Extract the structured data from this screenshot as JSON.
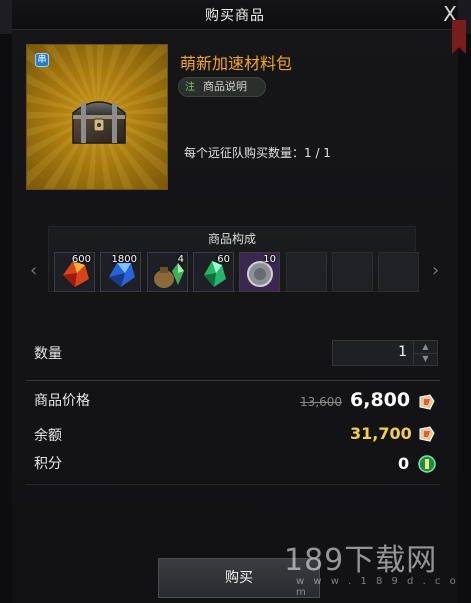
{
  "dialog": {
    "title": "购买商品",
    "close_label": "X"
  },
  "item": {
    "name": "萌新加速材料包",
    "badge": "串",
    "description_button": "商品说明",
    "description_icon": "注",
    "purchase_limit": "每个远征队购买数量：1 / 1"
  },
  "composition": {
    "title": "商品构成",
    "slots": [
      {
        "icon": "red-gem-icon",
        "qty": "600"
      },
      {
        "icon": "blue-gem-icon",
        "qty": "1800"
      },
      {
        "icon": "pouch-gem-icon",
        "qty": "4"
      },
      {
        "icon": "green-gem-icon",
        "qty": "60"
      },
      {
        "icon": "purple-coin-icon",
        "qty": "10"
      },
      {
        "icon": "",
        "qty": ""
      },
      {
        "icon": "",
        "qty": ""
      },
      {
        "icon": "",
        "qty": ""
      }
    ]
  },
  "quantity": {
    "label": "数量",
    "value": "1"
  },
  "price": {
    "label": "商品价格",
    "original": "13,600",
    "current": "6,800"
  },
  "balance": {
    "label": "余额",
    "value": "31,700"
  },
  "points": {
    "label": "积分",
    "value": "0"
  },
  "buy_button": "购买",
  "watermark": {
    "text": "189下载网",
    "url": "w w w . 1 8 9 d . c o m"
  },
  "colors": {
    "item_name": "#f5a623",
    "balance": "#f2d04a",
    "frame_gold": "#a97b10"
  }
}
